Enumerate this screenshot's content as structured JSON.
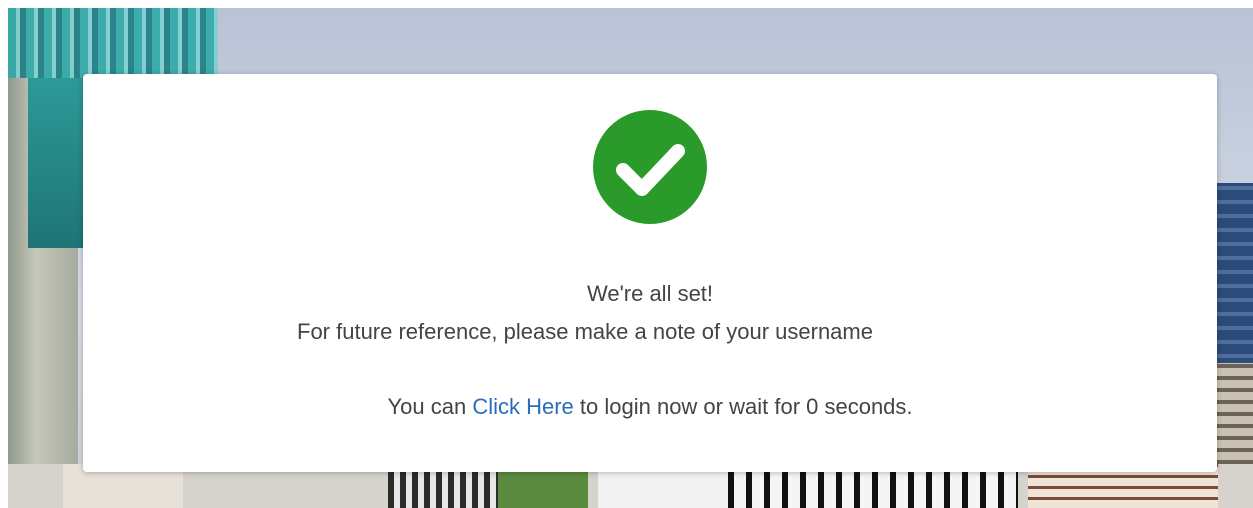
{
  "dialog": {
    "icon": "checkmark-circle-icon",
    "success_color": "#2a9a2a",
    "title": "We're all set!",
    "note": "For future reference, please make a note of your username",
    "login_prefix": "You can",
    "login_link": "Click Here",
    "login_suffix": "to login now or wait for 0 seconds."
  },
  "colors": {
    "text": "#444444",
    "link": "#2a6ebb"
  }
}
